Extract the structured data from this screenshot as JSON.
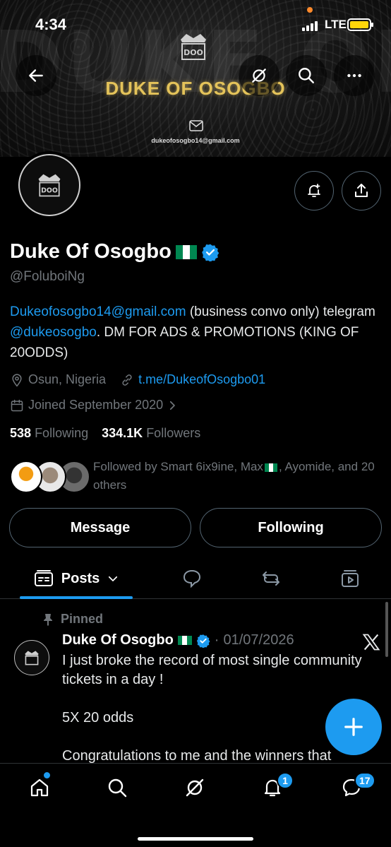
{
  "status_bar": {
    "time": "4:34",
    "network": "LTE"
  },
  "banner": {
    "title": "DUKE OF OSOGBO",
    "email": "dukeofosogbo14@gmail.com",
    "background_text": "DUKE OF OSOGBO"
  },
  "top_actions": {
    "back": "back-arrow-icon",
    "grok": "grok-icon",
    "search": "search-icon",
    "more": "more-icon"
  },
  "profile": {
    "name": "Duke Of Osogbo",
    "handle": "@FoluboiNg",
    "bio_link_email": "Dukeofosogbo14@gmail.com",
    "bio_text1": " (business convo only) telegram ",
    "bio_link_telegram": "@dukeosogbo",
    "bio_text2": ". DM FOR ADS & PROMOTIONS (KING OF 20ODDS)",
    "location": "Osun, Nigeria",
    "website": "t.me/DukeofOsogbo01",
    "joined": "Joined September 2020",
    "following_count": "538",
    "following_label": "Following",
    "followers_count": "334.1K",
    "followers_label": "Followers",
    "followed_by": "Followed by Smart 6ix9ine, Max",
    "followed_by_rest": ", Ayomide, and 20 others"
  },
  "buttons": {
    "message": "Message",
    "following": "Following"
  },
  "tabs": {
    "posts": "Posts"
  },
  "pinned_post": {
    "pinned_label": "Pinned",
    "author": "Duke Of Osogbo",
    "date": "01/07/2026",
    "separator": "·",
    "line1": "I just broke the record of most single community tickets in a day !",
    "line2": "5X 20 odds",
    "line3": "Congratulations to me and the winners that"
  },
  "bottom_nav": {
    "notifications_badge": "1",
    "messages_badge": "17"
  },
  "colors": {
    "accent": "#1d9bf0",
    "gold": "#e4c35a",
    "muted": "#71767b"
  }
}
